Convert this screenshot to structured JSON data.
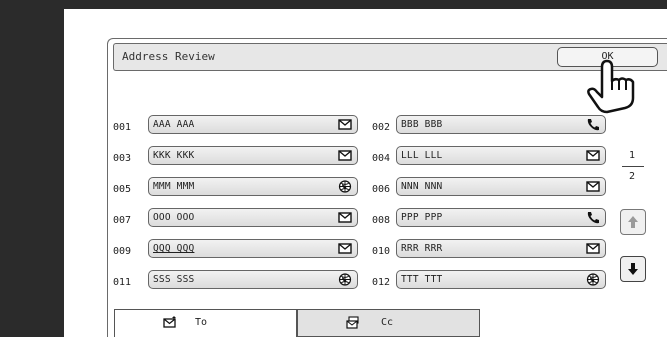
{
  "header": {
    "title": "Address Review",
    "ok_label": "OK"
  },
  "entries": [
    {
      "num": "001",
      "name": "AAA AAA",
      "icon": "envelope-icon"
    },
    {
      "num": "002",
      "name": "BBB BBB",
      "icon": "phone-icon"
    },
    {
      "num": "003",
      "name": "KKK KKK",
      "icon": "envelope-icon"
    },
    {
      "num": "004",
      "name": "LLL LLL",
      "icon": "envelope-icon"
    },
    {
      "num": "005",
      "name": "MMM MMM",
      "icon": "internet-fax-icon"
    },
    {
      "num": "006",
      "name": "NNN NNN",
      "icon": "envelope-icon"
    },
    {
      "num": "007",
      "name": "OOO OOO",
      "icon": "envelope-icon"
    },
    {
      "num": "008",
      "name": "PPP PPP",
      "icon": "phone-icon"
    },
    {
      "num": "009",
      "name": "QQQ QQQ",
      "icon": "envelope-icon"
    },
    {
      "num": "010",
      "name": "RRR RRR",
      "icon": "envelope-icon"
    },
    {
      "num": "011",
      "name": "SSS SSS",
      "icon": "internet-fax-icon"
    },
    {
      "num": "012",
      "name": "TTT TTT",
      "icon": "internet-fax-icon"
    }
  ],
  "pagination": {
    "current": "1",
    "total": "2"
  },
  "tabs": [
    {
      "label": "To",
      "icon": "envelope-icon",
      "active": true
    },
    {
      "label": "Cc",
      "icon": "cc-icon",
      "active": false
    }
  ]
}
